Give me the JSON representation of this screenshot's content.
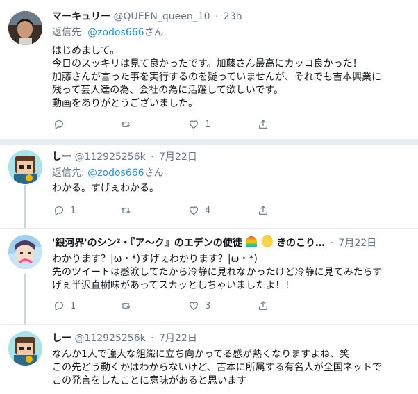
{
  "tweets": [
    {
      "name": "マーキュリー",
      "handle": "@QUEEN_queen_10",
      "time": "23h",
      "reply_label": "返信先: ",
      "reply_mention": "@zodos666",
      "reply_suffix": "さん",
      "body": "はじめまして。\n今日のスッキリは見て良かったです。加藤さん最高にカッコ良かった！\n加藤さんが言った事を実行するのを疑っていませんが、それでも吉本興業に\n残って芸人達の為、会社の為に活躍して欲しいです。\n動画をありがとうございました。",
      "replies": "",
      "retweets": "",
      "likes": "1"
    },
    {
      "name": "しー",
      "handle": "@112925256k",
      "time": "7月22日",
      "reply_label": "返信先: ",
      "reply_mention": "@zodos666",
      "reply_suffix": "さん",
      "body": "わかる。すげぇわかる。",
      "replies": "1",
      "retweets": "",
      "likes": "4"
    },
    {
      "name": "'銀河界'のシン²・『ア～ク』のエデンの使徒",
      "name_tail": "きのこり…",
      "handle": "",
      "time": "7月22日",
      "body": "わかります？|ω・*)すげぇわかります？|ω・*)\n先のツイートは感涙してたから冷静に見れなかったけど冷静に見てみたらす\nげぇ半沢直樹味があってスカッとしちゃいましたよ！！",
      "replies": "1",
      "retweets": "",
      "likes": "3"
    },
    {
      "name": "しー",
      "handle": "@112925256k",
      "time": "7月22日",
      "body": "なんか1人で強大な組織に立ち向かってる感が熱くなりますよね、笑\nこの先どう動くかはわからないけど、吉本に所属する有名人が全国ネットで\nこの発言をしたことに意味があると思います"
    }
  ],
  "icons": {
    "reply": "reply-icon",
    "retweet": "retweet-icon",
    "like": "heart-icon",
    "share": "share-icon"
  },
  "colors": {
    "link": "#1b95e0",
    "secondary_text": "#657786",
    "divider": "#e6ecf0"
  }
}
